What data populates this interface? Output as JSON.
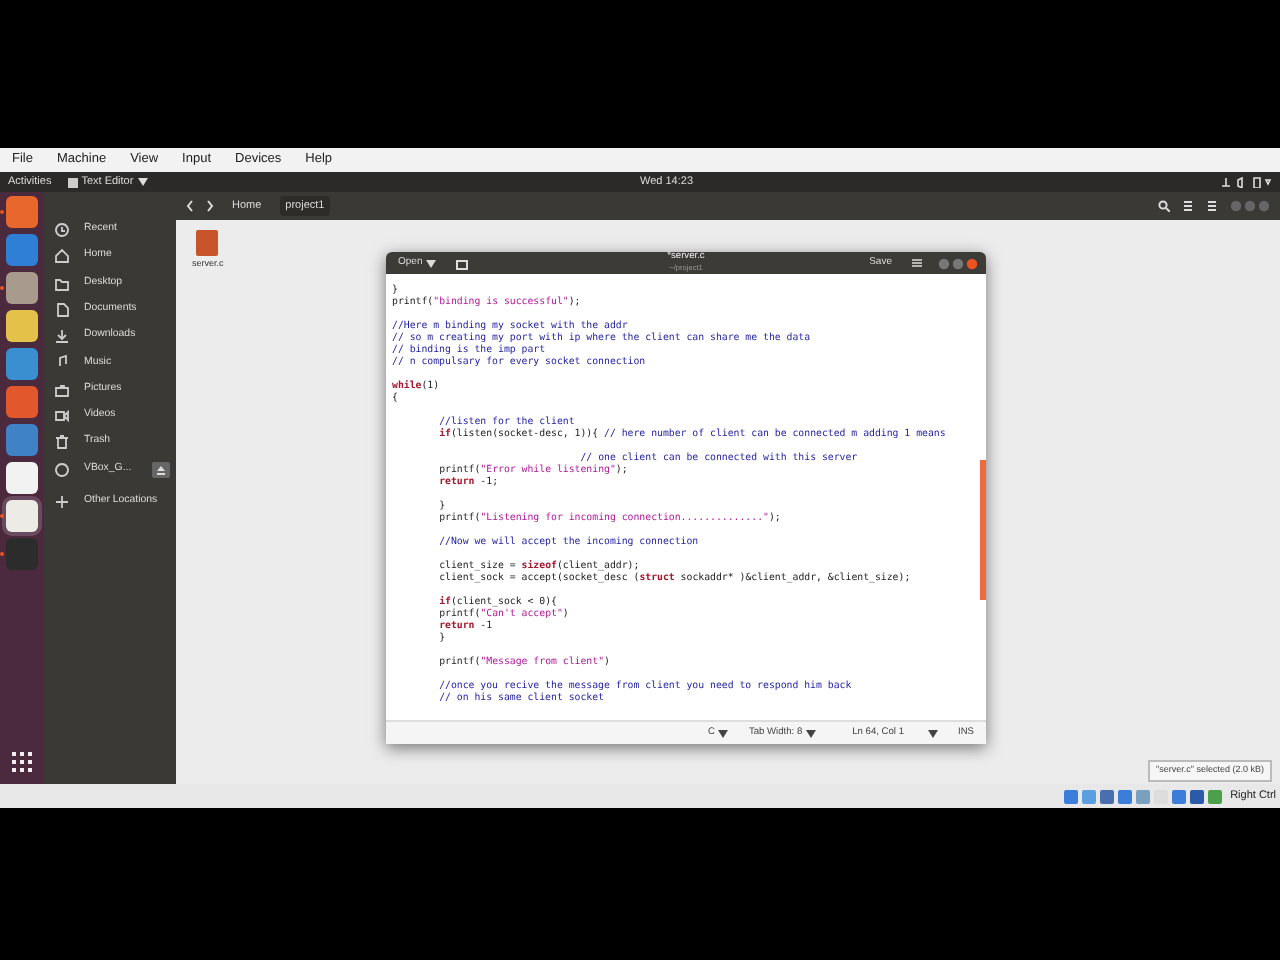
{
  "vbox_menu": [
    "File",
    "Machine",
    "View",
    "Input",
    "Devices",
    "Help"
  ],
  "top_bar": {
    "activities": "Activities",
    "app_menu": "Text Editor",
    "clock": "Wed 14:23"
  },
  "dock": [
    {
      "running": true
    },
    {
      "running": false
    },
    {
      "running": true
    },
    {
      "running": false
    },
    {
      "running": false
    },
    {
      "running": false
    },
    {
      "running": false
    },
    {
      "running": false
    },
    {
      "running": true
    },
    {
      "running": true
    }
  ],
  "file_manager": {
    "path": [
      "Home",
      "project1"
    ],
    "sidebar": [
      {
        "label": "Recent"
      },
      {
        "label": "Home"
      },
      {
        "label": "Desktop"
      },
      {
        "label": "Documents"
      },
      {
        "label": "Downloads"
      },
      {
        "label": "Music"
      },
      {
        "label": "Pictures"
      },
      {
        "label": "Videos"
      },
      {
        "label": "Trash"
      },
      {
        "label": "VBox_G...",
        "eject": true
      },
      {
        "label": "Other Locations"
      }
    ],
    "files": [
      {
        "name": "server.c"
      }
    ],
    "status": "\"server.c\" selected (2.0 kB)"
  },
  "editor": {
    "open_button": "Open",
    "title": "*server.c",
    "subtitle": "~/project1",
    "save_button": "Save",
    "lines": [
      {
        "kind": "code",
        "tokens": [
          {
            "kind": "plain",
            "text": "}"
          }
        ]
      },
      {
        "kind": "code",
        "tokens": [
          {
            "kind": "plain",
            "text": "printf("
          },
          {
            "kind": "string",
            "text": "\"binding is successful\""
          },
          {
            "kind": "plain",
            "text": ");"
          }
        ]
      },
      {
        "kind": "blank"
      },
      {
        "kind": "code",
        "tokens": [
          {
            "kind": "comment",
            "text": "//Here m binding my socket with the addr"
          }
        ]
      },
      {
        "kind": "code",
        "tokens": [
          {
            "kind": "comment",
            "text": "// so m creating my port with ip where the client can share me the data"
          }
        ]
      },
      {
        "kind": "code",
        "tokens": [
          {
            "kind": "comment",
            "text": "// binding is the imp part"
          }
        ]
      },
      {
        "kind": "code",
        "tokens": [
          {
            "kind": "comment",
            "text": "// n compulsary for every socket connection"
          }
        ]
      },
      {
        "kind": "blank"
      },
      {
        "kind": "code",
        "tokens": [
          {
            "kind": "keyword",
            "text": "while"
          },
          {
            "kind": "plain",
            "text": "(1)"
          }
        ]
      },
      {
        "kind": "code",
        "tokens": [
          {
            "kind": "plain",
            "text": "{"
          }
        ]
      },
      {
        "kind": "blank"
      },
      {
        "kind": "code",
        "tokens": [
          {
            "kind": "comment",
            "text": "\t//listen for the client"
          }
        ]
      },
      {
        "kind": "code",
        "tokens": [
          {
            "kind": "keyword",
            "text": "\tif"
          },
          {
            "kind": "plain",
            "text": "(listen(socket-desc, 1)){ "
          },
          {
            "kind": "comment",
            "text": "// here number of client can be connected m adding 1 means"
          }
        ]
      },
      {
        "kind": "blank"
      },
      {
        "kind": "code",
        "tokens": [
          {
            "kind": "comment",
            "text": "\t\t\t\t// one client can be connected with this server"
          }
        ]
      },
      {
        "kind": "code",
        "tokens": [
          {
            "kind": "plain",
            "text": "\tprintf("
          },
          {
            "kind": "string",
            "text": "\"Error while listening\""
          },
          {
            "kind": "plain",
            "text": ");"
          }
        ]
      },
      {
        "kind": "code",
        "tokens": [
          {
            "kind": "keyword",
            "text": "\treturn"
          },
          {
            "kind": "plain",
            "text": " -1;"
          }
        ]
      },
      {
        "kind": "blank"
      },
      {
        "kind": "code",
        "tokens": [
          {
            "kind": "plain",
            "text": "\t}"
          }
        ]
      },
      {
        "kind": "code",
        "tokens": [
          {
            "kind": "plain",
            "text": "\tprintf("
          },
          {
            "kind": "string",
            "text": "\"Listening for incoming connection..............\""
          },
          {
            "kind": "plain",
            "text": ");"
          }
        ]
      },
      {
        "kind": "blank"
      },
      {
        "kind": "code",
        "tokens": [
          {
            "kind": "comment",
            "text": "\t//Now we will accept the incoming connection"
          }
        ]
      },
      {
        "kind": "blank"
      },
      {
        "kind": "code",
        "tokens": [
          {
            "kind": "plain",
            "text": "\tclient_size = "
          },
          {
            "kind": "keyword",
            "text": "sizeof"
          },
          {
            "kind": "plain",
            "text": "(client_addr);"
          }
        ]
      },
      {
        "kind": "code",
        "tokens": [
          {
            "kind": "plain",
            "text": "\tclient_sock = accept(socket_desc ("
          },
          {
            "kind": "keyword",
            "text": "struct"
          },
          {
            "kind": "plain",
            "text": " sockaddr* )&client_addr, &client_size);"
          }
        ]
      },
      {
        "kind": "blank"
      },
      {
        "kind": "code",
        "tokens": [
          {
            "kind": "keyword",
            "text": "\tif"
          },
          {
            "kind": "plain",
            "text": "(client_sock < 0){"
          }
        ]
      },
      {
        "kind": "code",
        "tokens": [
          {
            "kind": "plain",
            "text": "\tprintf("
          },
          {
            "kind": "string",
            "text": "\"Can't accept\""
          },
          {
            "kind": "plain",
            "text": ")"
          }
        ]
      },
      {
        "kind": "code",
        "tokens": [
          {
            "kind": "keyword",
            "text": "\treturn"
          },
          {
            "kind": "plain",
            "text": " -1"
          }
        ]
      },
      {
        "kind": "code",
        "tokens": [
          {
            "kind": "plain",
            "text": "\t}"
          }
        ]
      },
      {
        "kind": "blank"
      },
      {
        "kind": "code",
        "tokens": [
          {
            "kind": "plain",
            "text": "\tprintf("
          },
          {
            "kind": "string",
            "text": "\"Message from client\""
          },
          {
            "kind": "plain",
            "text": ")"
          }
        ]
      },
      {
        "kind": "blank"
      },
      {
        "kind": "code",
        "tokens": [
          {
            "kind": "comment",
            "text": "\t//once you recive the message from client you need to respond him back"
          }
        ]
      },
      {
        "kind": "code",
        "tokens": [
          {
            "kind": "comment",
            "text": "\t// on his same client socket"
          }
        ]
      }
    ],
    "status_bar": {
      "language": "C",
      "tab_width": "Tab Width: 8",
      "position": "Ln 64, Col 1",
      "mode": "INS"
    }
  },
  "vbox_status": {
    "host_key": "Right Ctrl"
  }
}
